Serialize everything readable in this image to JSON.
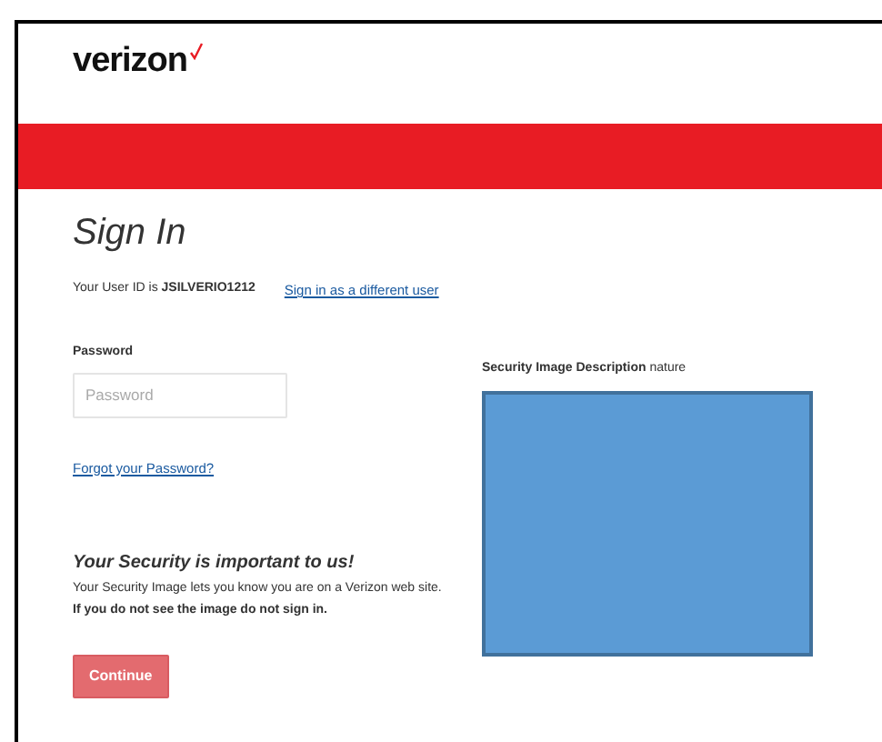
{
  "logo": {
    "text": "verizon"
  },
  "title": "Sign In",
  "user_id": {
    "text": "Your User ID is **JSILVERIO1212**",
    "link": "Sign in as a different user"
  },
  "password": {
    "label": "Password",
    "placeholder": "Password"
  },
  "forgot_link": "Forgot your Password?",
  "security_image": {
    "label": "**Security Image Description** nature"
  },
  "security_note": {
    "title": "Your Security is important to us!",
    "lines": [
      {
        "text": "Your Security Image lets you know you are on a Verizon web site.",
        "bold": false
      },
      {
        "text": "If you do not see the image do not sign in.",
        "bold": true
      }
    ]
  },
  "buttons": [
    {
      "label": "Continue",
      "disabled": false
    }
  ]
}
